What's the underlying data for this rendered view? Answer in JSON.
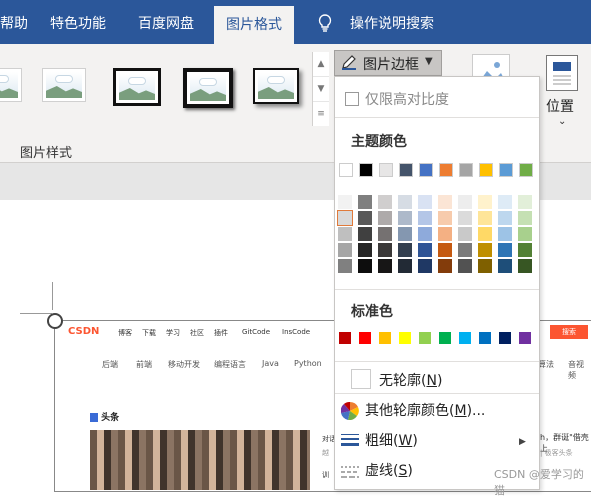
{
  "tabs": [
    {
      "label": "帮助"
    },
    {
      "label": "特色功能"
    },
    {
      "label": "百度网盘"
    },
    {
      "label": "图片格式"
    },
    {
      "label": "操作说明搜索"
    }
  ],
  "ribbon": {
    "gallery_label": "图片样式",
    "picture_border_label": "图片边框",
    "position_label": "位置"
  },
  "dropdown": {
    "lock_aspect_label": "仅限高对比度",
    "theme_colors_title": "主题颜色",
    "theme_colors_top": [
      "#ffffff",
      "#000000",
      "#e7e6e6",
      "#44546a",
      "#4472c4",
      "#ed7d31",
      "#a5a5a5",
      "#ffc000",
      "#5b9bd5",
      "#70ad47"
    ],
    "theme_shades": [
      [
        "#f2f2f2",
        "#d9d9d9",
        "#bfbfbf",
        "#a6a6a6",
        "#808080"
      ],
      [
        "#7f7f7f",
        "#595959",
        "#404040",
        "#262626",
        "#0d0d0d"
      ],
      [
        "#d0cece",
        "#aeaaaa",
        "#757171",
        "#3a3838",
        "#171616"
      ],
      [
        "#d6dce4",
        "#adb9ca",
        "#8497b0",
        "#333f4f",
        "#222a35"
      ],
      [
        "#d9e2f3",
        "#b4c6e7",
        "#8eaadb",
        "#2f5496",
        "#1f3864"
      ],
      [
        "#fbe5d5",
        "#f7cbac",
        "#f4b083",
        "#c55a11",
        "#833c0b"
      ],
      [
        "#ededed",
        "#dbdbdb",
        "#c9c9c9",
        "#7b7b7b",
        "#525252"
      ],
      [
        "#fff2cc",
        "#fee599",
        "#ffd966",
        "#bf8f00",
        "#7f6000"
      ],
      [
        "#deebf6",
        "#bdd7ee",
        "#9dc3e6",
        "#2e75b5",
        "#1e4e79"
      ],
      [
        "#e2efd9",
        "#c5e0b3",
        "#a8d08d",
        "#538135",
        "#375623"
      ]
    ],
    "standard_colors_title": "标准色",
    "standard_colors": [
      "#c00000",
      "#ff0000",
      "#ffc000",
      "#ffff00",
      "#92d050",
      "#00b050",
      "#00b0f0",
      "#0070c0",
      "#002060",
      "#7030a0"
    ],
    "no_outline_text": "无轮廓",
    "no_outline_key": "N",
    "more_colors_text": "其他轮廓颜色(",
    "more_colors_key": "M",
    "more_colors_suffix": ")...",
    "weight_text": "粗细",
    "weight_key": "W",
    "dashes_text": "虚线",
    "dashes_key": "S"
  },
  "document": {
    "csdn_logo": "CSDN",
    "csdn_links": [
      "博客",
      "下载",
      "学习",
      "社区",
      "插件",
      "GitCode",
      "InsCode"
    ],
    "csdn_search": "搜索",
    "csdn_nav": [
      "后端",
      "前端",
      "移动开发",
      "编程语言",
      "Java",
      "Python",
      "算法",
      "音视频"
    ],
    "csdn_headline": "头条",
    "csdn_text": [
      "对话",
      "越",
      "训"
    ],
    "csdn_side_text": "h，群诞\"借壳上",
    "csdn_side_link": "| 极客头条"
  },
  "watermark": "CSDN @爱学习的猫"
}
